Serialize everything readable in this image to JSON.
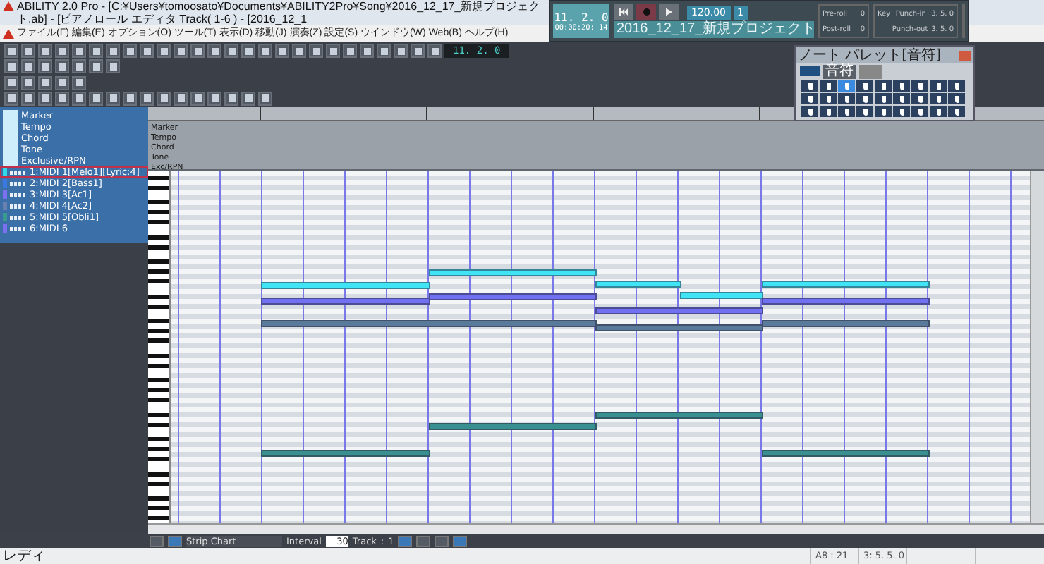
{
  "window": {
    "title": "ABILITY 2.0 Pro - [C:¥Users¥tomoosato¥Documents¥ABILITY2Pro¥Song¥2016_12_17_新規プロジェクト.ab] - [ピアノロール エディタ Track( 1-6 ) - [2016_12_1"
  },
  "menu": [
    "ファイル(F)",
    "編集(E)",
    "オプション(O)",
    "ツール(T)",
    "表示(D)",
    "移動(J)",
    "演奏(Z)",
    "設定(S)",
    "ウインドウ(W)",
    "Web(B)",
    "ヘルプ(H)"
  ],
  "toolbar_counter": "11. 2. 0",
  "transport": {
    "counter": "11. 2. 0",
    "time": "00:00:20: 14",
    "tempo": "120.00",
    "beat": "1",
    "pre_roll_label": "Pre-roll",
    "pre_roll": "0",
    "post_roll_label": "Post-roll",
    "post_roll": "0",
    "key_label": "Key",
    "punch_in_label": "Punch-in",
    "punch_in": "3. 5. 0",
    "punch_out_label": "Punch-out",
    "punch_out": "3. 5. 0",
    "project": "2016_12_17_新規プロジェクト"
  },
  "note_palette": {
    "title": "ノート パレット[音符]",
    "tabs": [
      {
        "label": "音符",
        "selected": true
      }
    ]
  },
  "sidebar": {
    "rows": [
      "Marker",
      "Tempo",
      "Chord",
      "Tone",
      "Exclusive/RPN"
    ],
    "tracks": [
      {
        "label": "1:MIDI 1[Melo1][Lyric:4]",
        "color": "#30d8e8",
        "selected": true
      },
      {
        "label": "2:MIDI 2[Bass1]",
        "color": "#3a7ae0",
        "selected": false
      },
      {
        "label": "3:MIDI 3[Ac1]",
        "color": "#7a70f0",
        "selected": false
      },
      {
        "label": "4:MIDI 4[Ac2]",
        "color": "#6a80b0",
        "selected": false
      },
      {
        "label": "5:MIDI 5[Obli1]",
        "color": "#3a9a90",
        "selected": false
      },
      {
        "label": "6:MIDI 6",
        "color": "#7a70f0",
        "selected": false
      }
    ]
  },
  "ruler": {
    "rows": [
      "Marker",
      "Tempo",
      "Chord",
      "Tone",
      "Exc/RPN"
    ]
  },
  "bottom_bar": {
    "view": "Strip Chart",
    "interval_label": "Interval",
    "interval": "30",
    "track_label": "Track",
    "track_sep": ":",
    "track": "1"
  },
  "status_bar": {
    "text": "レディ",
    "fields": [
      "A8 : 21",
      "3: 5. 5. 0"
    ]
  }
}
